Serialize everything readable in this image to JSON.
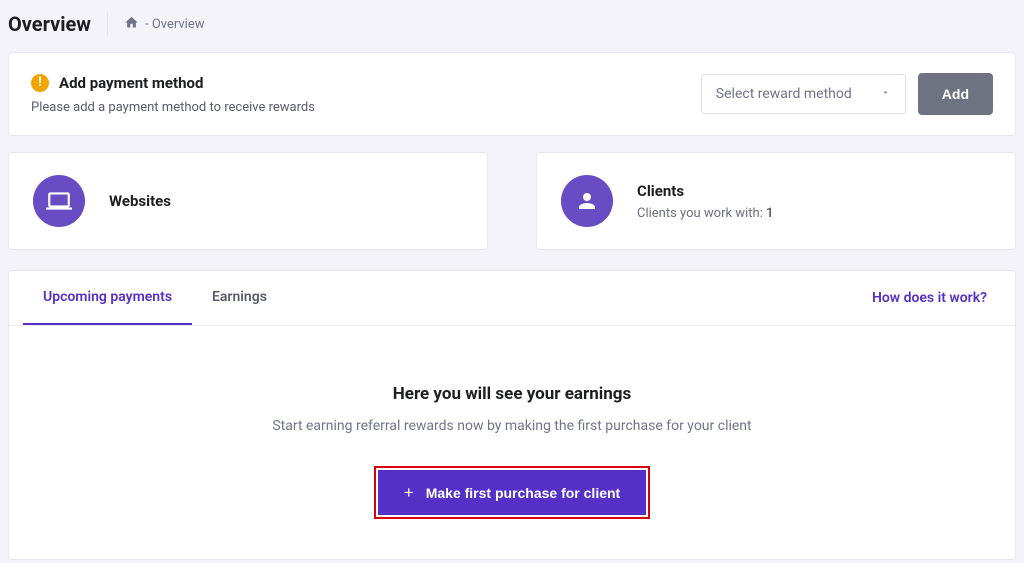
{
  "header": {
    "title": "Overview",
    "breadcrumb": "- Overview"
  },
  "payment_notice": {
    "title": "Add payment method",
    "sub": "Please add a payment method to receive rewards",
    "select_placeholder": "Select reward method",
    "add_label": "Add"
  },
  "websites_card": {
    "title": "Websites"
  },
  "clients_card": {
    "title": "Clients",
    "sub_prefix": "Clients you work with: ",
    "count": "1"
  },
  "tabs": {
    "upcoming": "Upcoming payments",
    "earnings": "Earnings",
    "how_link": "How does it work?"
  },
  "empty": {
    "title": "Here you will see your earnings",
    "sub": "Start earning referral rewards now by making the first purchase for your client",
    "cta": "Make first purchase for client"
  }
}
